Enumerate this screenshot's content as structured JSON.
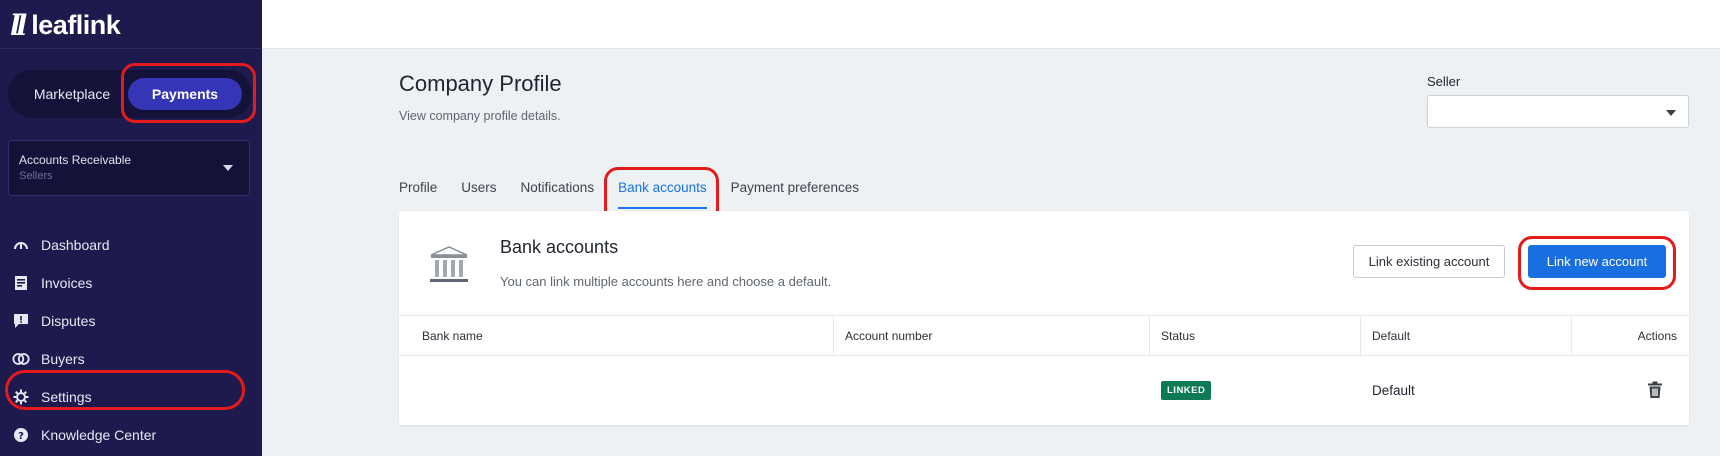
{
  "brand": {
    "mark": "ll",
    "name": "leaflink"
  },
  "switcher": {
    "marketplace": "Marketplace",
    "payments": "Payments"
  },
  "account_select": {
    "title": "Accounts Receivable",
    "subtitle": "Sellers"
  },
  "nav": [
    {
      "label": "Dashboard",
      "icon": "dashboard-icon"
    },
    {
      "label": "Invoices",
      "icon": "invoice-icon"
    },
    {
      "label": "Disputes",
      "icon": "dispute-icon"
    },
    {
      "label": "Buyers",
      "icon": "buyers-icon"
    },
    {
      "label": "Settings",
      "icon": "gear-icon"
    },
    {
      "label": "Knowledge Center",
      "icon": "help-icon"
    }
  ],
  "header": {
    "title": "Company Profile",
    "subtitle": "View company profile details."
  },
  "seller": {
    "label": "Seller",
    "value": ""
  },
  "tabs": [
    "Profile",
    "Users",
    "Notifications",
    "Bank accounts",
    "Payment preferences"
  ],
  "active_tab": "Bank accounts",
  "card": {
    "title": "Bank accounts",
    "subtitle": "You can link multiple accounts here and choose a default.",
    "link_existing": "Link existing account",
    "link_new": "Link new account"
  },
  "table": {
    "columns": [
      "Bank name",
      "Account number",
      "Status",
      "Default",
      "Actions"
    ],
    "rows": [
      {
        "bank_name": "",
        "account_number": "",
        "status": "LINKED",
        "default": "Default"
      }
    ]
  },
  "colors": {
    "sidebar": "#1e1a4d",
    "accent": "#1a6fe0",
    "linked": "#0d7a56",
    "highlight": "#e41b1b"
  }
}
